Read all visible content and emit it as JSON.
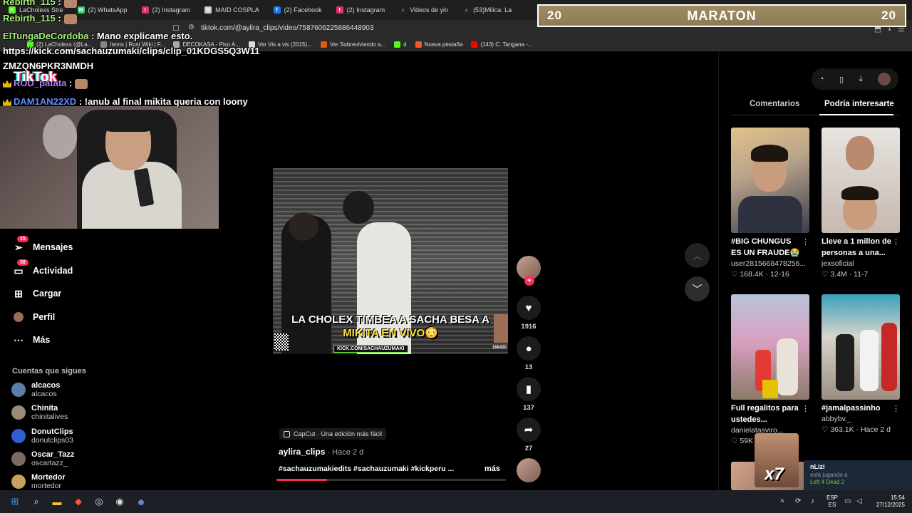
{
  "browser": {
    "tabs": [
      {
        "label": "LaCholexs Stre",
        "color": "#53fc18",
        "glyph": "K"
      },
      {
        "label": "(2) WhatsApp",
        "color": "#25d366",
        "glyph": "W"
      },
      {
        "label": "(2) Instagram",
        "color": "#e1306c",
        "glyph": "I"
      },
      {
        "label": "MAID COSPLA",
        "color": "#cccccc",
        "glyph": "G"
      },
      {
        "label": "(2) Facebook",
        "color": "#1877f2",
        "glyph": "f"
      },
      {
        "label": "(2) Instagram",
        "color": "#e1306c",
        "glyph": "I"
      },
      {
        "label": "Videos de yin",
        "color": "#222222",
        "glyph": "♪"
      },
      {
        "label": "(53)Milica: La",
        "color": "#222222",
        "glyph": "♪"
      }
    ],
    "url": "tiktok.com/@aylira_clips/video/7587606225886448903",
    "bookmarks": [
      {
        "label": "(2) LaCholexs (@La...",
        "color": "#53fc18"
      },
      {
        "label": "Items | Rust Wiki | F...",
        "color": "#888888"
      },
      {
        "label": "DECOKASA - Piso A...",
        "color": "#aaaaaa"
      },
      {
        "label": "Ver Vis a vis (2015)...",
        "color": "#dddddd"
      },
      {
        "label": "Ver Sobreviviendo a...",
        "color": "#e05a1c"
      },
      {
        "label": "d",
        "color": "#53fc18"
      },
      {
        "label": "Nueva pestaña",
        "color": "#fb542b"
      },
      {
        "label": "(143) C. Tangana -...",
        "color": "#ff0000"
      }
    ]
  },
  "overlay": {
    "maraton_left": "20",
    "maraton_title": "MARATON",
    "maraton_right": "20",
    "chat": [
      {
        "name": "Rebirth_115",
        "text": " :",
        "color": "green"
      },
      {
        "name": "Rebirth_115",
        "text": " :",
        "color": "green"
      },
      {
        "name": "ElTungaDeCordoba",
        "text": " : Mano explicame esto.",
        "color": "green"
      },
      {
        "name": "",
        "text": "https://kick.com/sachauzumaki/clips/clip_01KDGS5Q3W11",
        "color": "white"
      },
      {
        "name": "",
        "text": "ZMZQN6PKR3NMDH",
        "color": "white"
      },
      {
        "name": "ROD_patata",
        "text": " :",
        "color": "purple"
      },
      {
        "name": "DAM1AN22XD",
        "text": " : !anub al final mikita queria con loony",
        "color": "blue"
      }
    ],
    "tiktok_logo": "TikTok"
  },
  "sidebar": {
    "items": [
      {
        "label": "Mensajes",
        "icon": "paper-plane-icon",
        "badge": "15"
      },
      {
        "label": "Actividad",
        "icon": "inbox-icon",
        "badge": "38"
      },
      {
        "label": "Cargar",
        "icon": "plus-square-icon",
        "badge": ""
      },
      {
        "label": "Perfil",
        "icon": "avatar-icon",
        "badge": ""
      },
      {
        "label": "Más",
        "icon": "more-icon",
        "badge": ""
      }
    ],
    "following_title": "Cuentas que sigues",
    "following": [
      {
        "name": "alcacos",
        "handle": "alcacos",
        "color": "#5b7fa6"
      },
      {
        "name": "Chinita",
        "handle": "chinitalives",
        "color": "#9a8a7a"
      },
      {
        "name": "DonutClips",
        "handle": "donutclips03",
        "color": "#2f5fd0"
      },
      {
        "name": "Oscar_Tazz",
        "handle": "oscartazz_",
        "color": "#7a6a60"
      },
      {
        "name": "Mortedor",
        "handle": "mortedor",
        "color": "#c8a060"
      }
    ]
  },
  "video": {
    "caption_line1": "LA CHOLEX TIMBEA A SACHA BESA A",
    "caption_line2": "MIKITA EN VIVO😳",
    "kick_tag": "KICK.COM/SACHAUZUMAKI",
    "kick_count": "166420",
    "capcut": "CapCut · Una edición más fácil",
    "author": "aylira_clips",
    "time": " · Hace 2 d",
    "description": "#sachauzumakiedits #sachauzumaki #kickperu ...",
    "more": "más",
    "progress": 0.22
  },
  "actions": {
    "likes": "1916",
    "comments": "13",
    "saves": "137",
    "shares": "27"
  },
  "right_panel": {
    "tab_comments": "Comentarios",
    "tab_interest": "Podría interesarte",
    "cards": [
      {
        "title": "#BIG CHUNGUS ES UN FRAUDE😭",
        "user": "user2815668478256...",
        "meta": "♡ 168.4K · 12-16"
      },
      {
        "title": "Lleve a 1 millon de personas a una...",
        "user": "jexsoficial",
        "meta": "♡ 3.4M · 11-7"
      },
      {
        "title": "Full regalitos para ustedes...",
        "user": "danielatasviro...",
        "meta": "♡ 59K"
      },
      {
        "title": "#jamalpassinho",
        "user": "abbybv._",
        "meta": "♡ 363.1K · Hace 2 d"
      }
    ]
  },
  "notification": {
    "name": "nLizi",
    "sub": "está jugando a",
    "game": "Left 4 Dead 2",
    "x7": "x7"
  },
  "taskbar": {
    "lang1": "ESP",
    "lang2": "ES",
    "time": "15:54",
    "date": "27/12/2025"
  }
}
